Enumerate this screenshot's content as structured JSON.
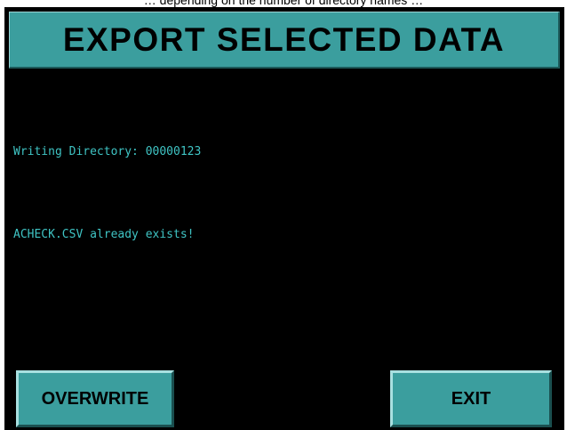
{
  "top_caption": "… depending on the number of directory names …",
  "screen": {
    "title": "EXPORT SELECTED DATA",
    "writing_directory_message": "Writing Directory: 00000123",
    "file_exists_message": "ACHECK.CSV already exists!",
    "buttons": {
      "overwrite_label": "OVERWRITE",
      "exit_label": "EXIT"
    }
  },
  "colors": {
    "background": "#000000",
    "panel_teal": "#3b9e9e",
    "message_text": "#3fc4c4"
  }
}
